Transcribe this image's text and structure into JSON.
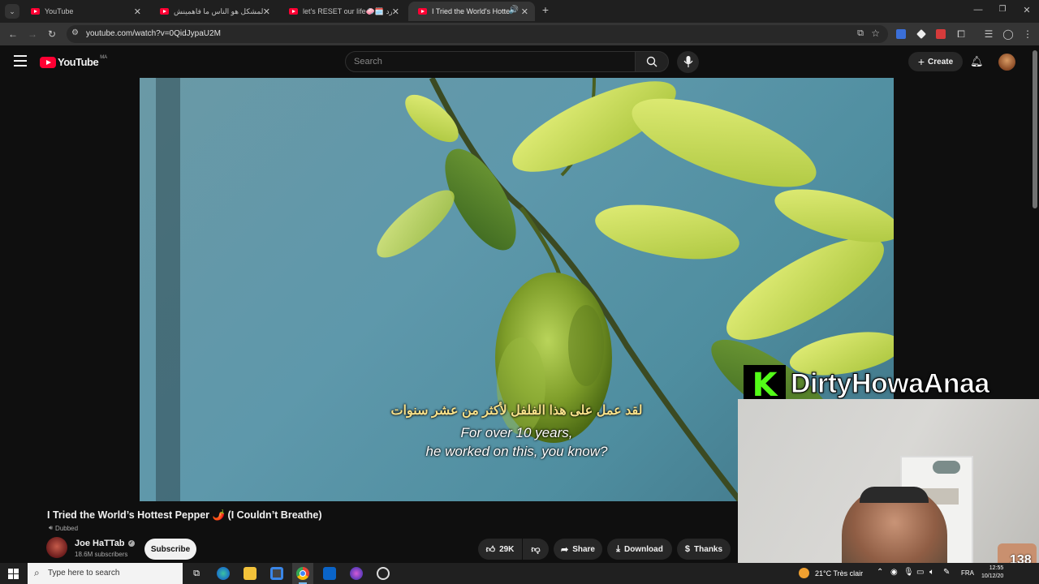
{
  "browser": {
    "tabs": [
      {
        "title": "YouTube",
        "active": false
      },
      {
        "title": "المشكل هو الناس ما فاهمينش ||",
        "active": false
      },
      {
        "title": "let's RESET our life🧼🗓️ البرد",
        "active": false
      },
      {
        "title": "I Tried the World's Hottest P",
        "active": true
      }
    ],
    "url": "youtube.com/watch?v=0QidJypaU2M"
  },
  "youtube": {
    "logo_text": "YouTube",
    "region": "MA",
    "search_placeholder": "Search",
    "create_label": "Create"
  },
  "video": {
    "caption_arabic": "لقد عمل على هذا الفلفل لأكثر من عشر سنوات",
    "caption_line1": "For over 10 years,",
    "caption_line2": "he worked on this, you know?",
    "title": "I Tried the World’s Hottest Pepper 🌶️ (I Couldn’t Breathe)",
    "dubbed_label": "Dubbed",
    "channel_name": "Joe HaTTab",
    "verified_icon": "verified-check-icon",
    "subscribers": "18.6M subscribers",
    "subscribe_label": "Subscribe",
    "likes": "29K",
    "share_label": "Share",
    "download_label": "Download",
    "thanks_label": "Thanks"
  },
  "overlay": {
    "streamer_name": "DirtyHowaAnaa",
    "kick_letter": "K",
    "counter": "138"
  },
  "taskbar": {
    "search_placeholder": "Type here to search",
    "weather": "21°C Très clair",
    "language": "FRA",
    "time": "12:55",
    "date": "10/12/20"
  },
  "colors": {
    "yt_red": "#ff0033",
    "kick_green": "#53fc18",
    "background": "#0f0f0f"
  }
}
